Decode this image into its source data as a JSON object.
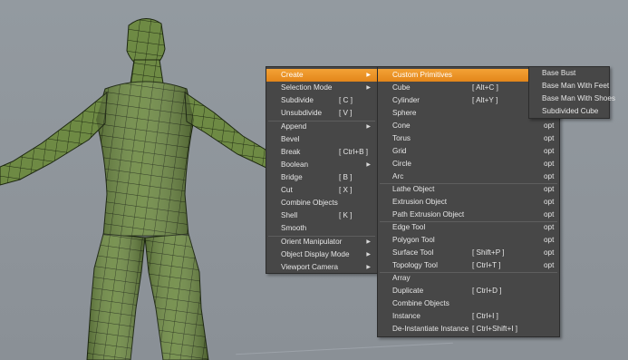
{
  "main_menu": {
    "items": [
      {
        "label": "Create",
        "shortcut": "",
        "submenu": true
      },
      {
        "label": "Selection Mode",
        "shortcut": "",
        "submenu": true
      },
      {
        "label": "Subdivide",
        "shortcut": "[ C ]",
        "submenu": false
      },
      {
        "label": "Unsubdivide",
        "shortcut": "[ V ]",
        "submenu": false
      },
      {
        "label": "Append",
        "shortcut": "",
        "submenu": true
      },
      {
        "label": "Bevel",
        "shortcut": "",
        "submenu": false
      },
      {
        "label": "Break",
        "shortcut": "[ Ctrl+B ]",
        "submenu": false
      },
      {
        "label": "Boolean",
        "shortcut": "",
        "submenu": true
      },
      {
        "label": "Bridge",
        "shortcut": "[ B ]",
        "submenu": false
      },
      {
        "label": "Cut",
        "shortcut": "[ X ]",
        "submenu": false
      },
      {
        "label": "Combine Objects",
        "shortcut": "",
        "submenu": false
      },
      {
        "label": "Shell",
        "shortcut": "[ K ]",
        "submenu": false
      },
      {
        "label": "Smooth",
        "shortcut": "",
        "submenu": false
      },
      {
        "label": "Orient Manipulator",
        "shortcut": "",
        "submenu": true
      },
      {
        "label": "Object Display Mode",
        "shortcut": "",
        "submenu": true
      },
      {
        "label": "Viewport Camera",
        "shortcut": "",
        "submenu": true
      }
    ]
  },
  "create_menu": {
    "items": [
      {
        "label": "Custom Primitives",
        "shortcut": "",
        "opt": "",
        "submenu": true
      },
      {
        "label": "Cube",
        "shortcut": "[ Alt+C ]",
        "opt": "opt"
      },
      {
        "label": "Cylinder",
        "shortcut": "[ Alt+Y ]",
        "opt": "opt"
      },
      {
        "label": "Sphere",
        "shortcut": "",
        "opt": "opt"
      },
      {
        "label": "Cone",
        "shortcut": "",
        "opt": "opt"
      },
      {
        "label": "Torus",
        "shortcut": "",
        "opt": "opt"
      },
      {
        "label": "Grid",
        "shortcut": "",
        "opt": "opt"
      },
      {
        "label": "Circle",
        "shortcut": "",
        "opt": "opt"
      },
      {
        "label": "Arc",
        "shortcut": "",
        "opt": "opt"
      },
      {
        "label": "Lathe Object",
        "shortcut": "",
        "opt": "opt"
      },
      {
        "label": "Extrusion Object",
        "shortcut": "",
        "opt": "opt"
      },
      {
        "label": "Path Extrusion Object",
        "shortcut": "",
        "opt": "opt"
      },
      {
        "label": "Edge Tool",
        "shortcut": "",
        "opt": "opt"
      },
      {
        "label": "Polygon Tool",
        "shortcut": "",
        "opt": "opt"
      },
      {
        "label": "Surface Tool",
        "shortcut": "[ Shift+P ]",
        "opt": "opt"
      },
      {
        "label": "Topology Tool",
        "shortcut": "[ Ctrl+T ]",
        "opt": "opt"
      },
      {
        "label": "Array",
        "shortcut": "",
        "opt": ""
      },
      {
        "label": "Duplicate",
        "shortcut": "[ Ctrl+D ]",
        "opt": ""
      },
      {
        "label": "Combine Objects",
        "shortcut": "",
        "opt": ""
      },
      {
        "label": "Instance",
        "shortcut": "[ Ctrl+I ]",
        "opt": ""
      },
      {
        "label": "De-Instantiate Instance",
        "shortcut": "[ Ctrl+Shift+I ]",
        "opt": ""
      }
    ]
  },
  "primitives_menu": {
    "items": [
      {
        "label": "Base Bust"
      },
      {
        "label": "Base Man With Feet"
      },
      {
        "label": "Base Man With Shoes"
      },
      {
        "label": "Subdivided Cube"
      }
    ]
  },
  "colors": {
    "highlight": "#e98e20",
    "menu_bg": "#474747",
    "viewport_bg": "#8e959b",
    "mesh": "#6f8b45"
  },
  "icons": {
    "submenu": "submenu-arrow-icon"
  }
}
